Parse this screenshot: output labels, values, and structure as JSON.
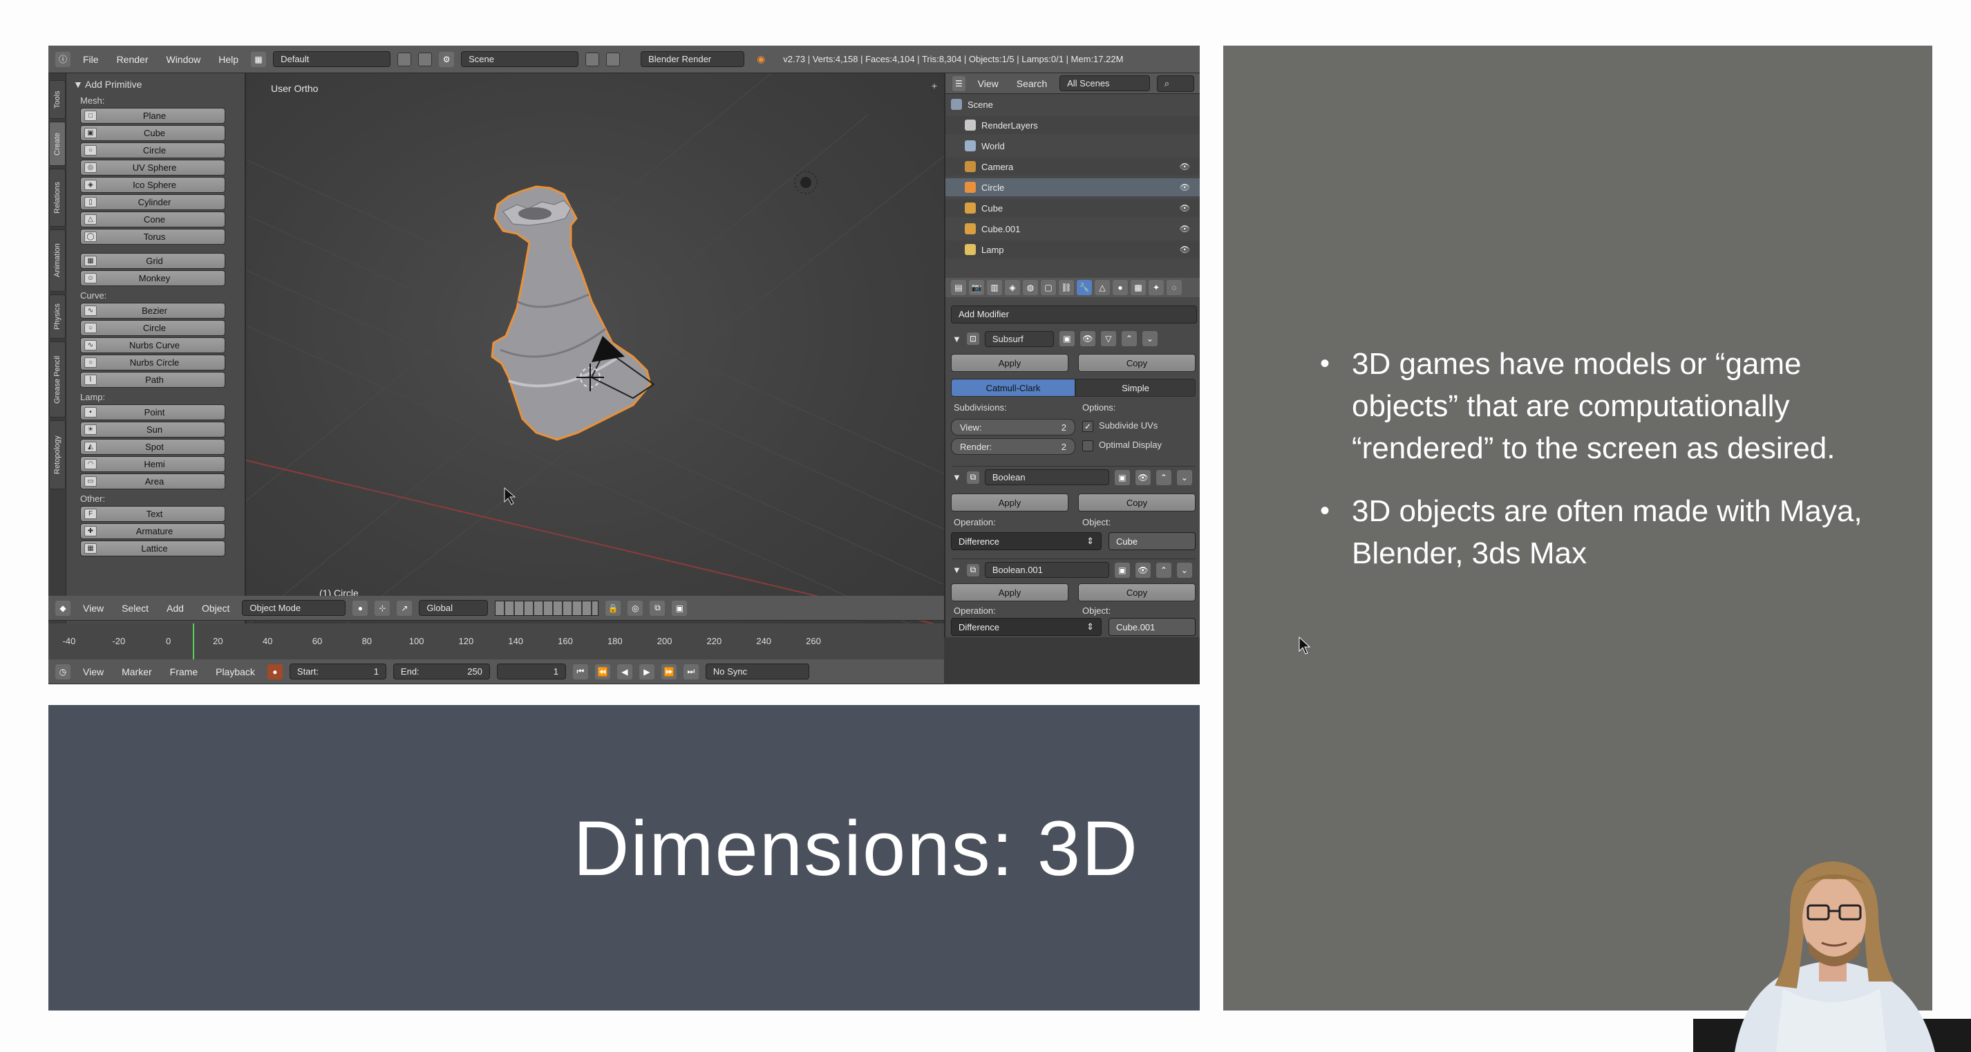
{
  "blender": {
    "topbar": {
      "menus": [
        "File",
        "Render",
        "Window",
        "Help"
      ],
      "layout": "Default",
      "scene": "Scene",
      "engine": "Blender Render",
      "stats": "v2.73 | Verts:4,158 | Faces:4,104 | Tris:8,304 | Objects:1/5 | Lamps:0/1 | Mem:17.22M"
    },
    "tabs": [
      "Tools",
      "Create",
      "Relations",
      "Animation",
      "Physics",
      "Grease Pencil",
      "Retopology"
    ],
    "shelf": {
      "title": "Add Primitive",
      "mesh_label": "Mesh:",
      "mesh": [
        "Plane",
        "Cube",
        "Circle",
        "UV Sphere",
        "Ico Sphere",
        "Cylinder",
        "Cone",
        "Torus",
        "Grid",
        "Monkey"
      ],
      "curve_label": "Curve:",
      "curve": [
        "Bezier",
        "Circle",
        "Nurbs Curve",
        "Nurbs Circle",
        "Path"
      ],
      "lamp_label": "Lamp:",
      "lamp": [
        "Point",
        "Sun",
        "Spot",
        "Hemi",
        "Area"
      ],
      "other_label": "Other:",
      "other": [
        "Text",
        "Armature",
        "Lattice"
      ]
    },
    "viewport": {
      "view_label": "User Ortho",
      "object_label": "(1) Circle"
    },
    "viewport_header": {
      "menus": [
        "View",
        "Select",
        "Add",
        "Object"
      ],
      "mode": "Object Mode",
      "orientation": "Global"
    },
    "ruler_ticks": [
      "-40",
      "-20",
      "0",
      "20",
      "40",
      "60",
      "80",
      "100",
      "120",
      "140",
      "160",
      "180",
      "200",
      "220",
      "240",
      "260"
    ],
    "timeline": {
      "menus": [
        "View",
        "Marker",
        "Frame",
        "Playback"
      ],
      "start": "Start:",
      "start_val": "1",
      "end": "End:",
      "end_val": "250",
      "current": "1",
      "sync": "No Sync"
    },
    "outliner": {
      "menus": [
        "View",
        "Search"
      ],
      "filter": "All Scenes",
      "items": [
        "Scene",
        "RenderLayers",
        "World",
        "Camera",
        "Circle",
        "Cube",
        "Cube.001",
        "Lamp"
      ]
    },
    "props": {
      "add_modifier": "Add Modifier",
      "mod1": {
        "name": "Subsurf",
        "apply": "Apply",
        "copy": "Copy",
        "tab_a": "Catmull-Clark",
        "tab_b": "Simple",
        "subdivisions": "Subdivisions:",
        "view_label": "View:",
        "view_val": "2",
        "render_label": "Render:",
        "render_val": "2",
        "options": "Options:",
        "opt1": "Subdivide UVs",
        "opt2": "Optimal Display"
      },
      "mod2": {
        "name": "Boolean",
        "apply": "Apply",
        "copy": "Copy",
        "operation": "Operation:",
        "op_val": "Difference",
        "object": "Object:",
        "obj_val": "Cube"
      },
      "mod3": {
        "name": "Boolean.001",
        "apply": "Apply",
        "copy": "Copy",
        "operation": "Operation:",
        "op_val": "Difference",
        "object": "Object:",
        "obj_val": "Cube.001"
      }
    }
  },
  "slide": {
    "title": "Dimensions: 3D",
    "bullets": [
      "3D games have models or “game objects” that are computationally “rendered” to the screen as desired.",
      "3D objects are often made with Maya, Blender, 3ds Max"
    ]
  },
  "colors": {
    "title_panel": "#4a515c",
    "right_panel": "#6b6b68",
    "selection_orange": "#e8913a",
    "active_tab_blue": "#5680c2"
  }
}
